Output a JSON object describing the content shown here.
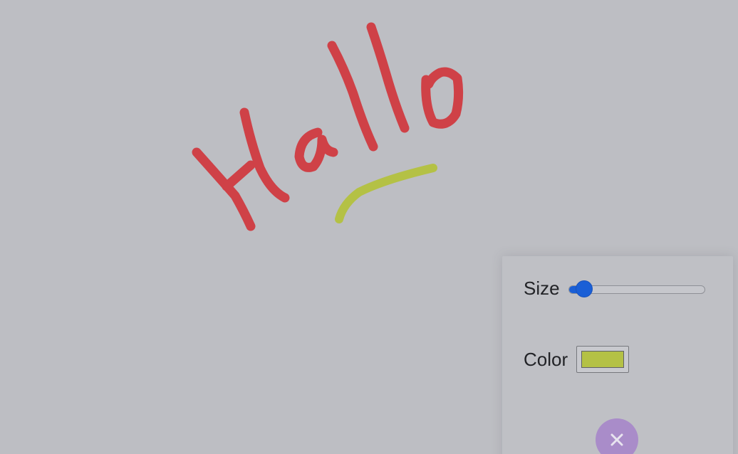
{
  "canvas": {
    "background": "#bdbec3",
    "strokes": [
      {
        "word": "Hallo",
        "color": "#cf4147"
      },
      {
        "word": "underline",
        "color": "#b4c145"
      }
    ]
  },
  "panel": {
    "size": {
      "label": "Size",
      "value_fraction": 0.12,
      "accent_color": "#1a5fd6"
    },
    "color": {
      "label": "Color",
      "selected_color": "#b4c145"
    },
    "close_button": {
      "icon": "close-icon",
      "background": "#a98cc9"
    }
  }
}
